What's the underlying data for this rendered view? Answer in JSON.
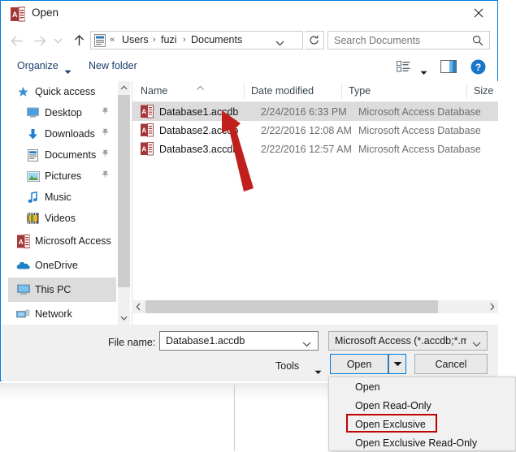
{
  "window": {
    "title": "Open",
    "title_icon": "microsoft-access-icon",
    "close_label": "✕"
  },
  "nav": {
    "back": "back-arrow-icon",
    "forward": "forward-arrow-icon",
    "recent": "recent-locations-icon",
    "up": "up-arrow-icon",
    "refresh_label": "refresh-icon",
    "breadcrumb_icon": "documents-folder-icon",
    "breadcrumb_overflow": "«",
    "breadcrumb": [
      "Users",
      "fuzi",
      "Documents"
    ],
    "separator": "›",
    "chevron": "chevron-down-icon"
  },
  "search": {
    "placeholder": "Search Documents",
    "icon": "search-icon"
  },
  "toolbar": {
    "organize_label": "Organize",
    "new_folder_label": "New folder",
    "view_icon": "change-view-icon",
    "pane_icon": "preview-pane-icon",
    "help_icon": "help-icon"
  },
  "sidebar": {
    "items": [
      {
        "label": "Quick access",
        "icon": "star-icon",
        "indent": false,
        "pinned": false,
        "selected": false
      },
      {
        "label": "Desktop",
        "icon": "desktop-icon",
        "indent": true,
        "pinned": true,
        "selected": false
      },
      {
        "label": "Downloads",
        "icon": "downloads-icon",
        "indent": true,
        "pinned": true,
        "selected": false
      },
      {
        "label": "Documents",
        "icon": "documents-icon",
        "indent": true,
        "pinned": true,
        "selected": false
      },
      {
        "label": "Pictures",
        "icon": "pictures-icon",
        "indent": true,
        "pinned": true,
        "selected": false
      },
      {
        "label": "Music",
        "icon": "music-icon",
        "indent": true,
        "pinned": false,
        "selected": false
      },
      {
        "label": "Videos",
        "icon": "videos-icon",
        "indent": true,
        "pinned": false,
        "selected": false
      },
      {
        "label": "Microsoft Access",
        "icon": "microsoft-access-icon",
        "indent": false,
        "pinned": false,
        "selected": false
      },
      {
        "label": "OneDrive",
        "icon": "onedrive-icon",
        "indent": false,
        "pinned": false,
        "selected": false
      },
      {
        "label": "This PC",
        "icon": "this-pc-icon",
        "indent": false,
        "pinned": false,
        "selected": true
      },
      {
        "label": "Network",
        "icon": "network-icon",
        "indent": false,
        "pinned": false,
        "selected": false
      }
    ]
  },
  "filelist": {
    "columns": [
      "Name",
      "Date modified",
      "Type",
      "Size"
    ],
    "sort_indicator": "sort-ascending-icon",
    "rows": [
      {
        "name": "Database1.accdb",
        "date": "2/24/2016 6:33 PM",
        "type": "Microsoft Access Database",
        "size": "",
        "selected": true
      },
      {
        "name": "Database2.accdb",
        "date": "2/22/2016 12:08 AM",
        "type": "Microsoft Access Database",
        "size": "",
        "selected": false
      },
      {
        "name": "Database3.accdb",
        "date": "2/22/2016 12:57 AM",
        "type": "Microsoft Access Database",
        "size": "",
        "selected": false
      }
    ]
  },
  "footer": {
    "filename_label": "File name:",
    "filename_value": "Database1.accdb",
    "filetype_value": "Microsoft Access (*.accdb;*.mc",
    "tools_label": "Tools",
    "open_label": "Open",
    "cancel_label": "Cancel",
    "split_icon": "dropdown-arrow-icon"
  },
  "dropdown": {
    "items": [
      {
        "label": "Open",
        "highlighted": false
      },
      {
        "label": "Open Read-Only",
        "highlighted": false
      },
      {
        "label": "Open Exclusive",
        "highlighted": true
      },
      {
        "label": "Open Exclusive Read-Only",
        "highlighted": false
      }
    ]
  },
  "annotation": {
    "arrow": "red-arrow-annotation"
  },
  "colors": {
    "accent": "#0078d7",
    "annotation_red": "#c00000",
    "selection": "#dcdcdc",
    "link_text": "#1b3d6b"
  }
}
